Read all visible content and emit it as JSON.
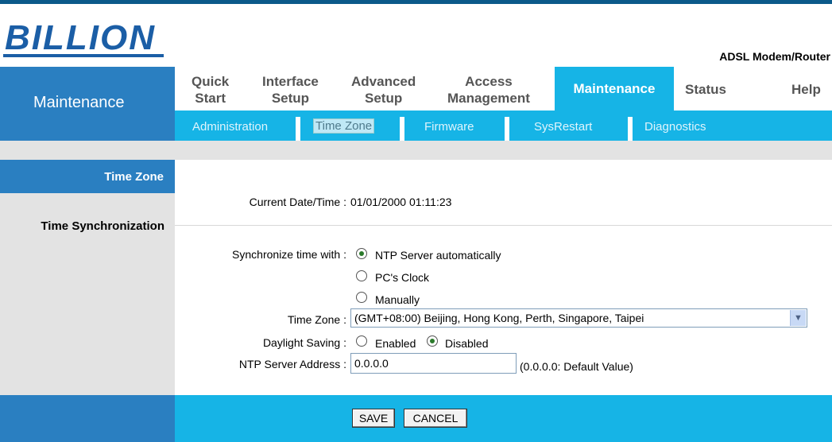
{
  "header": {
    "brand": "BILLION",
    "product": "ADSL Modem/Router"
  },
  "left_nav": {
    "title": "Maintenance"
  },
  "menu": {
    "items": [
      {
        "line1": "Quick",
        "line2": "Start"
      },
      {
        "line1": "Interface",
        "line2": "Setup"
      },
      {
        "line1": "Advanced",
        "line2": "Setup"
      },
      {
        "line1": "Access",
        "line2": "Management"
      }
    ],
    "active": "Maintenance",
    "status": "Status",
    "help": "Help"
  },
  "submenu": {
    "items": [
      "Administration",
      "Time Zone",
      "Firmware",
      "SysRestart",
      "Diagnostics"
    ],
    "selected": "Time Zone"
  },
  "sections": {
    "time_zone": "Time Zone",
    "time_sync": "Time Synchronization"
  },
  "form": {
    "current_label": "Current Date/Time :",
    "current_value": "01/01/2000 01:11:23",
    "sync_label": "Synchronize time with :",
    "sync_options": [
      "NTP Server automatically",
      "PC's Clock",
      "Manually"
    ],
    "sync_selected": "NTP Server automatically",
    "tz_label": "Time Zone :",
    "tz_value": "(GMT+08:00) Beijing, Hong Kong, Perth, Singapore, Taipei",
    "dst_label": "Daylight Saving :",
    "dst_options": [
      "Enabled",
      "Disabled"
    ],
    "dst_selected": "Disabled",
    "ntp_label": "NTP Server Address :",
    "ntp_value": "0.0.0.0",
    "ntp_hint": "(0.0.0.0: Default Value)"
  },
  "buttons": {
    "save": "SAVE",
    "cancel": "CANCEL"
  },
  "colors": {
    "primary_blue": "#2a7fc1",
    "light_blue": "#16b4e6",
    "gray": "#e3e3e3"
  }
}
